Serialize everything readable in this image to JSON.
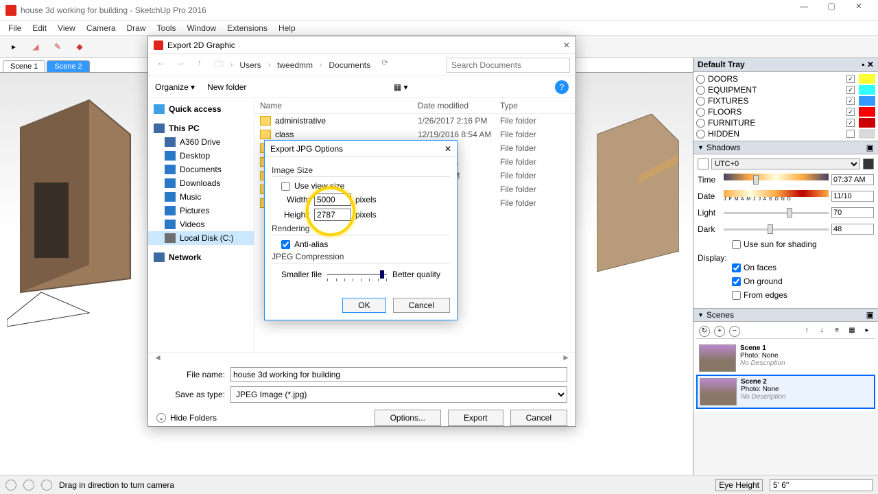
{
  "window": {
    "title": "house 3d working for building - SketchUp Pro 2016",
    "min": "—",
    "max": "▢",
    "close": "✕"
  },
  "menu": [
    "File",
    "Edit",
    "View",
    "Camera",
    "Draw",
    "Tools",
    "Window",
    "Extensions",
    "Help"
  ],
  "sceneTabs": [
    {
      "label": "Scene 1",
      "active": false
    },
    {
      "label": "Scene 2",
      "active": true
    }
  ],
  "tray": {
    "title": "Default Tray",
    "layers": [
      {
        "name": "DOORS",
        "visible": true,
        "color": "#ffff33"
      },
      {
        "name": "EQUIPMENT",
        "visible": true,
        "color": "#33ffff"
      },
      {
        "name": "FIXTURES",
        "visible": true,
        "color": "#3399ff"
      },
      {
        "name": "FLOORS",
        "visible": true,
        "color": "#ff0000"
      },
      {
        "name": "FURNITURE",
        "visible": true,
        "color": "#cc0000"
      },
      {
        "name": "HIDDEN",
        "visible": false,
        "color": "#d9d9d9"
      }
    ],
    "shadows": {
      "title": "Shadows",
      "tz": "UTC+0",
      "timeLabel": "Time",
      "timeVal": "07:37 AM",
      "dateLabel": "Date",
      "dateMonths": "J F M A M J J A S O N D",
      "dateVal": "11/10",
      "lightLabel": "Light",
      "lightVal": "70",
      "darkLabel": "Dark",
      "darkVal": "48",
      "useSun": "Use sun for shading",
      "displayLabel": "Display:",
      "onFaces": "On faces",
      "onGround": "On ground",
      "fromEdges": "From edges"
    },
    "scenes": {
      "title": "Scenes",
      "items": [
        {
          "name": "Scene 1",
          "photo": "Photo: None",
          "desc": "No Description"
        },
        {
          "name": "Scene 2",
          "photo": "Photo: None",
          "desc": "No Description"
        }
      ]
    }
  },
  "status": {
    "hint": "Drag in direction to turn camera",
    "eyeLabel": "Eye Height",
    "eyeVal": "5' 6\""
  },
  "exportDlg": {
    "title": "Export 2D Graphic",
    "crumbs": [
      "Users",
      "tweedmm",
      "Documents"
    ],
    "searchPlaceholder": "Search Documents",
    "organize": "Organize ▾",
    "newFolder": "New folder",
    "side": [
      {
        "label": "Quick access",
        "color": "#3fa0e8",
        "bold": true
      },
      {
        "label": "This PC",
        "color": "#3d6aa3",
        "bold": true
      },
      {
        "label": "A360 Drive",
        "color": "#3d6aa3",
        "sub": true
      },
      {
        "label": "Desktop",
        "color": "#2a79c6",
        "sub": true
      },
      {
        "label": "Documents",
        "color": "#2a79c6",
        "sub": true
      },
      {
        "label": "Downloads",
        "color": "#2a79c6",
        "sub": true
      },
      {
        "label": "Music",
        "color": "#2a79c6",
        "sub": true
      },
      {
        "label": "Pictures",
        "color": "#2a79c6",
        "sub": true
      },
      {
        "label": "Videos",
        "color": "#2a79c6",
        "sub": true
      },
      {
        "label": "Local Disk (C:)",
        "color": "#6e6e6e",
        "sub": true,
        "sel": true
      },
      {
        "label": "Network",
        "color": "#3d6aa3",
        "bold": true
      }
    ],
    "cols": [
      "Name",
      "Date modified",
      "Type"
    ],
    "files": [
      {
        "name": "administrative",
        "date": "1/26/2017 2:16 PM",
        "type": "File folder"
      },
      {
        "name": "class",
        "date": "12/19/2016 8:54 AM",
        "type": "File folder"
      },
      {
        "name": "",
        "date": "7 8:23 AM",
        "type": "File folder"
      },
      {
        "name": "",
        "date": "16 10:05 ...",
        "type": "File folder"
      },
      {
        "name": "",
        "date": "6 12:43 PM",
        "type": "File folder"
      },
      {
        "name": "",
        "date": "1:29 PM",
        "type": "File folder"
      },
      {
        "name": "",
        "date": "7 2:06 PM",
        "type": "File folder"
      }
    ],
    "fileNameLabel": "File name:",
    "fileName": "house 3d working for building",
    "saveTypeLabel": "Save as type:",
    "saveType": "JPEG Image (*.jpg)",
    "hideFolders": "Hide Folders",
    "optionsBtn": "Options...",
    "exportBtn": "Export",
    "cancelBtn": "Cancel"
  },
  "jpgDlg": {
    "title": "Export JPG Options",
    "imageSize": "Image Size",
    "useView": "Use view size",
    "widthLabel": "Width:",
    "widthVal": "5000",
    "px": "pixels",
    "heightLabel": "Height:",
    "heightVal": "2787",
    "rendering": "Rendering",
    "aa": "Anti-alias",
    "jpegComp": "JPEG Compression",
    "smaller": "Smaller file",
    "better": "Better quality",
    "ok": "OK",
    "cancel": "Cancel"
  }
}
